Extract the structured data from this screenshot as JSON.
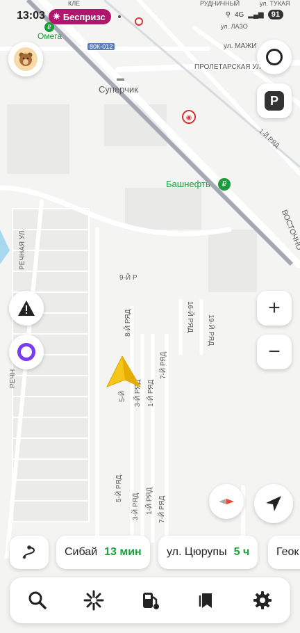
{
  "status": {
    "time": "13:03",
    "ad_label": "Беспризс",
    "network": "4G",
    "battery": "91"
  },
  "map_labels": {
    "omega": "Омега",
    "road_code": "80К-012",
    "superchik": "Суперчик",
    "bashneft": "Башнефть",
    "rudnichny": "РУДНИЧНЫЙ",
    "tukaya": "ул. ТУКАЯ",
    "lazo": "ул. ЛАЗО",
    "mazhi": "ул. МАЖИ",
    "proletarskaya": "ПРОЛЕТАРСКАЯ УЛ",
    "ryad1": "1-Й РЯД",
    "vostochnaya": "ВОСТОЧНО",
    "rechnaya": "РЕЧНАЯ УЛ.",
    "rechn": "РЕЧН",
    "r9": "9-Й Р",
    "r8": "8-Й РЯД",
    "r16": "16-Й РЯД",
    "r19": "19-Й РЯД",
    "r7a": "7-Й РЯД",
    "r1a": "1-Й РЯД",
    "r3a": "3-Й РЯД",
    "r5a": "5-Й",
    "r5b": "5-Й РЯД",
    "r3b": "3-Й РЯД",
    "r1b": "1-Й РЯД",
    "r7b": "7-Й РЯД",
    "kle": "КЛЕ"
  },
  "controls": {
    "zoom_in": "+",
    "zoom_out": "−",
    "parking": "P"
  },
  "routes": [
    {
      "dest": "Сибай",
      "eta": "13 мин"
    },
    {
      "dest": "ул. Цюрупы",
      "eta": "5 ч"
    },
    {
      "dest": "Геок",
      "eta": ""
    }
  ],
  "colors": {
    "accent_green": "#1aa33a",
    "ad_pink": "#b0166e",
    "alice_purple": "#7a3cf0",
    "arrow_yellow": "#f5c518"
  }
}
